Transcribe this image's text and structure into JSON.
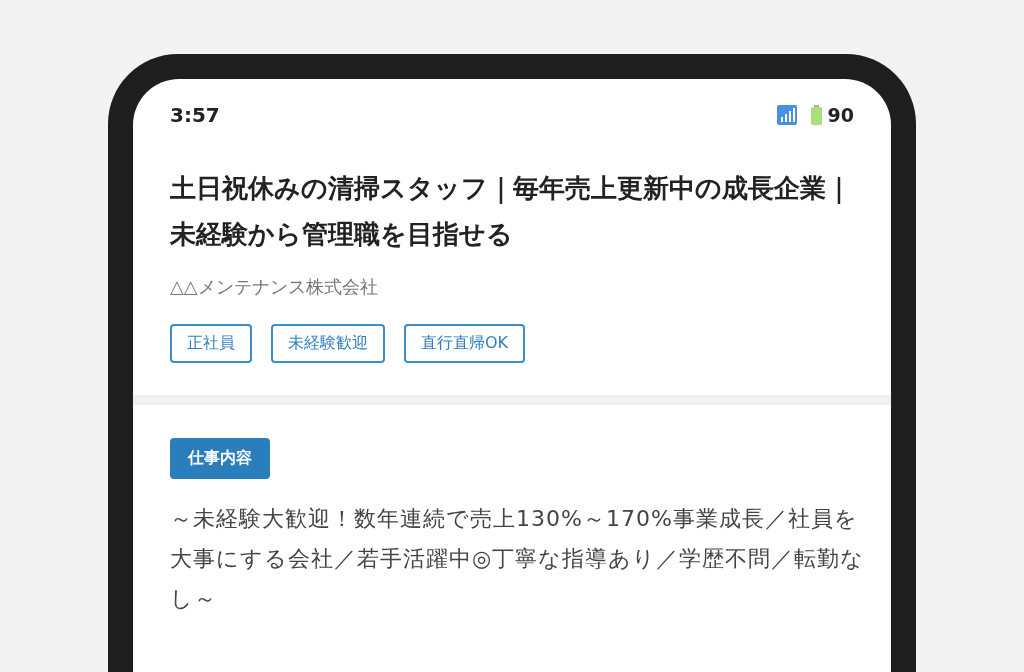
{
  "status_bar": {
    "time": "3:57",
    "battery": "90"
  },
  "job": {
    "title": "土日祝休みの清掃スタッフ｜毎年売上更新中の成長企業｜未経験から管理職を目指せる",
    "company": "△△メンテナンス株式会社",
    "tags": [
      "正社員",
      "未経験歓迎",
      "直行直帰OK"
    ]
  },
  "section": {
    "heading": "仕事内容",
    "body": "～未経験大歓迎！数年連続で売上130%～170%事業成長／社員を大事にする会社／若手活躍中◎丁寧な指導あり／学歴不問／転勤なし～"
  }
}
